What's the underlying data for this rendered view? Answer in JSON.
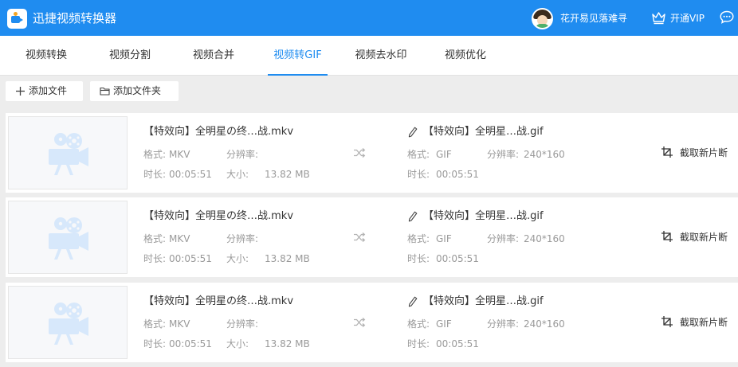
{
  "app": {
    "title": "迅捷视频转换器"
  },
  "user": {
    "name": "花开易见落难寻"
  },
  "vip": {
    "label": "开通VIP"
  },
  "tabs": [
    {
      "label": "视频转换"
    },
    {
      "label": "视频分割"
    },
    {
      "label": "视频合并"
    },
    {
      "label": "视频转GIF",
      "active": true
    },
    {
      "label": "视频去水印"
    },
    {
      "label": "视频优化"
    }
  ],
  "toolbar": {
    "add_file": "添加文件",
    "add_folder": "添加文件夹"
  },
  "labels": {
    "format": "格式:",
    "resolution": "分辨率:",
    "duration": "时长:",
    "size": "大小:",
    "crop": "截取新片断"
  },
  "files": [
    {
      "source": {
        "name": "【特效向】全明星の终…战.mkv",
        "format": "MKV",
        "resolution": "",
        "duration": "00:05:51",
        "size": "13.82 MB"
      },
      "output": {
        "name": "【特效向】全明星…战.gif",
        "format": "GIF",
        "resolution": "240*160",
        "duration": "00:05:51"
      }
    },
    {
      "source": {
        "name": "【特效向】全明星の终…战.mkv",
        "format": "MKV",
        "resolution": "",
        "duration": "00:05:51",
        "size": "13.82 MB"
      },
      "output": {
        "name": "【特效向】全明星…战.gif",
        "format": "GIF",
        "resolution": "240*160",
        "duration": "00:05:51"
      }
    },
    {
      "source": {
        "name": "【特效向】全明星の终…战.mkv",
        "format": "MKV",
        "resolution": "",
        "duration": "00:05:51",
        "size": "13.82 MB"
      },
      "output": {
        "name": "【特效向】全明星…战.gif",
        "format": "GIF",
        "resolution": "240*160",
        "duration": "00:05:51"
      }
    }
  ],
  "colors": {
    "accent": "#1f8cf0",
    "muted_text": "#9a9a9a",
    "background": "#ededed"
  }
}
